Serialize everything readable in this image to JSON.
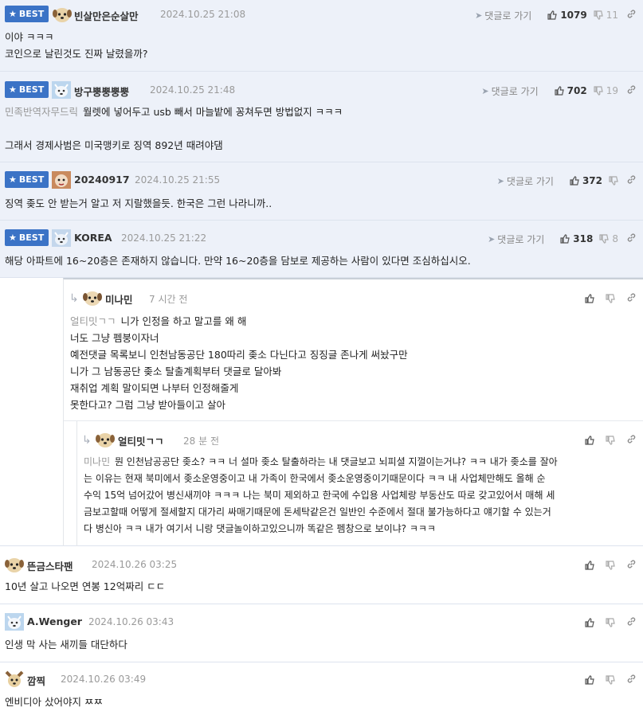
{
  "goto_label": "댓글로 가기",
  "best_label": "BEST",
  "comments": [
    {
      "nick": "빈살만은순살만",
      "date": "2024.10.25 21:08",
      "up": "1079",
      "down": "11",
      "lines": [
        "이야 ㅋㅋㅋ",
        "코인으로 날린것도 진짜 날렸을까?"
      ]
    },
    {
      "nick": "방구뿡뿡뿡뿡",
      "date": "2024.10.25 21:48",
      "up": "702",
      "down": "19",
      "mention": "민족반역자무드릭",
      "lines": [
        "월렛에 넣어두고 usb 빼서 마늘밭에 꽁쳐두면 방법없지 ㅋㅋㅋ",
        "",
        "그래서 경제사범은 미국맹키로 징역 892년 때려야댐"
      ]
    },
    {
      "nick": "20240917",
      "date": "2024.10.25 21:55",
      "up": "372",
      "down": "",
      "lines": [
        "징역 좆도 안 받는거 알고 저 지랄했을듯. 한국은 그런 나라니까.."
      ]
    },
    {
      "nick": "KOREA",
      "date": "2024.10.25 21:22",
      "up": "318",
      "down": "8",
      "lines": [
        "해당 아파트에 16~20층은 존재하지 않습니다. 만약 16~20층을 담보로 제공하는 사람이 있다면 조심하십시오."
      ]
    },
    {
      "nick": "미나민",
      "date": "7 시간 전",
      "mention": "얼티밋ㄱㄱ",
      "lines": [
        "니가 인정을 하고 말고를 왜 해",
        "너도 그냥 펨붕이자너",
        "예전댓글 목록보니 인천남동공단 180따리 좆소 다닌다고 징징글 존나게 써놨구만",
        "니가 그 남동공단 좆소 탈출계획부터 댓글로 달아봐",
        "재취업 계획 말이되면 나부터 인정해줄게",
        "못한다고? 그럼 그냥 받아들이고 살아"
      ]
    },
    {
      "nick": "얼티밋ㄱㄱ",
      "date": "28 분 전",
      "mention": "미나민",
      "lines": [
        "뭔 인천남공공단 좆소? ㅋㅋ 너 설마 좆소 탈출하라는 내 댓글보고 뇌피셜 지껄이는거냐? ㅋㅋ 내가 좆소를 잘아",
        "는 이유는 현재 북미에서 좆소운영중이고 내 가족이 한국에서 좆소운영중이기때문이다 ㅋㅋ 내 사업체만해도 올해 순",
        "수익 15억 넘어갔어 병신새끼야 ㅋㅋㅋ 나는 북미 제외하고 한국에 수입용 사업체랑 부동산도 따로 갖고있어서 매해 세",
        "금보고할때 어떻게 절세할지 대가리 싸매기때문에 돈세탁같은건 일반인 수준에서 절대 불가능하다고 얘기할 수 있는거",
        "다 병신아 ㅋㅋ 내가 여기서 니랑 댓글놀이하고있으니까 똑같은 펨창으로 보이냐? ㅋㅋㅋ"
      ]
    },
    {
      "nick": "뜬금스타팬",
      "date": "2024.10.26 03:25",
      "lines": [
        "10년 살고 나오면 연봉 12억짜리 ㄷㄷ"
      ]
    },
    {
      "nick": "A.Wenger",
      "date": "2024.10.26 03:43",
      "lines": [
        "인생 막 사는 새끼들 대단하다"
      ]
    },
    {
      "nick": "깜찍",
      "date": "2024.10.26 03:49",
      "lines": [
        "엔비디아 샀어야지 ㅉㅉ"
      ]
    }
  ]
}
